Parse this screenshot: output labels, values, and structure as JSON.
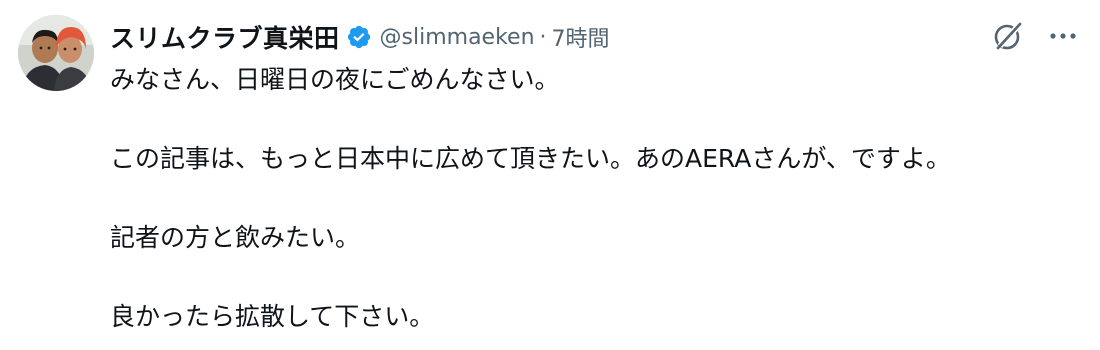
{
  "tweet": {
    "display_name": "スリムクラブ真栄田",
    "handle": "@slimmaeken",
    "separator": "·",
    "time": "7時間",
    "verified": true,
    "paragraphs": [
      "みなさん、日曜日の夜にごめんなさい。",
      "この記事は、もっと日本中に広めて頂きたい。あのAERAさんが、ですよ。",
      "記者の方と飲みたい。",
      "良かったら拡散して下さい。"
    ]
  },
  "icons": {
    "avatar": "avatar",
    "verified": "verified-badge-icon",
    "grok": "grok-icon",
    "more": "more-options-icon"
  },
  "colors": {
    "text": "#0f1419",
    "secondary": "#536471",
    "verified_blue": "#1d9bf0"
  }
}
